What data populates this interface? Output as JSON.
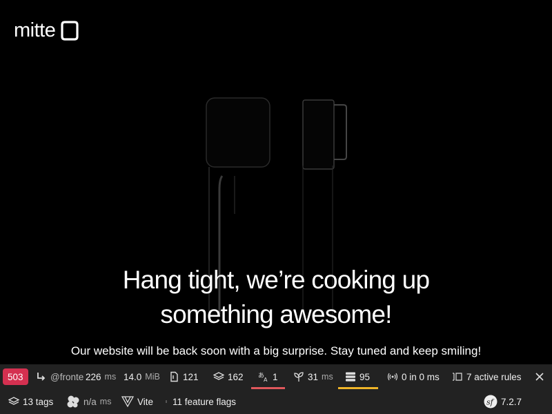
{
  "brand": {
    "name": "mitte"
  },
  "hero": {
    "headline_line1": "Hang tight, we’re cooking up",
    "headline_line2": "something awesome!",
    "subline": "Our website will be back soon with a big surprise. Stay tuned and keep smiling!"
  },
  "debug_toolbar": {
    "status_code": "503",
    "route": "@fronte",
    "request_time": {
      "value": "226",
      "unit": "ms"
    },
    "memory": {
      "value": "14.0",
      "unit": "MiB"
    },
    "templates": "121",
    "forms": "162",
    "translations": "1",
    "twig": {
      "value": "31",
      "unit": "ms"
    },
    "db_queries": "95",
    "http_client": "0 in 0 ms",
    "security_rules": "7 active rules",
    "cache_tags": "13 tags",
    "ajax": {
      "value": "n/a",
      "unit": "ms"
    },
    "vite": "Vite",
    "feature_flags": "11 feature flags",
    "symfony_version": "7.2.7",
    "colors": {
      "status_error": "#d43050",
      "bar_bg": "#222222",
      "warning": "#f0b529",
      "danger": "#e0585c"
    }
  }
}
